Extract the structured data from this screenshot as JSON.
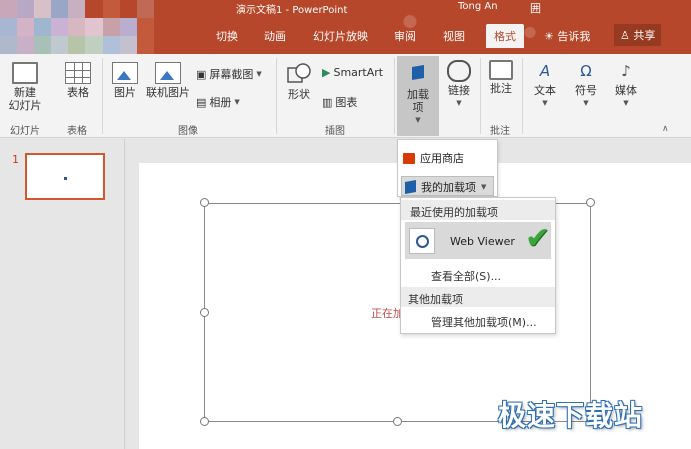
{
  "titlebar": {
    "document": "演示文稿1 - PowerPoint",
    "user": "Tong An",
    "window_control": "囲"
  },
  "tabs": [
    {
      "label": "切换"
    },
    {
      "label": "动画"
    },
    {
      "label": "幻灯片放映"
    },
    {
      "label": "审阅"
    },
    {
      "label": "视图"
    },
    {
      "label": "格式",
      "active": true
    }
  ],
  "tell_me": "告诉我",
  "share": "共享",
  "ribbon": {
    "new_slide": "新建\n幻灯片",
    "table": "表格",
    "picture": "图片",
    "online_picture": "联机图片",
    "screenshot": "屏幕截图",
    "album": "相册",
    "shapes": "形状",
    "smartart": "SmartArt",
    "chart": "图表",
    "addins": "加载\n项",
    "link": "链接",
    "comment": "批注",
    "text": "文本",
    "symbol": "符号",
    "media": "媒体",
    "groups": {
      "slides": "幻灯片",
      "tables": "表格",
      "images": "图像",
      "illustrations": "插图",
      "comments": "批注"
    }
  },
  "addins_menu": {
    "store": "应用商店",
    "my_addins": "我的加载项"
  },
  "my_addins_menu": {
    "recent_header": "最近使用的加载项",
    "recent_item": "Web Viewer",
    "view_all": "查看全部(S)...",
    "other_header": "其他加载项",
    "manage": "管理其他加载项(M)..."
  },
  "slides": {
    "thumb_number": "1",
    "loading_text": "正在加"
  },
  "watermark": "极速下载站",
  "colors": {
    "accent": "#b7472a",
    "check": "#3aa53a",
    "watermark_outline": "#2d6fb3"
  }
}
